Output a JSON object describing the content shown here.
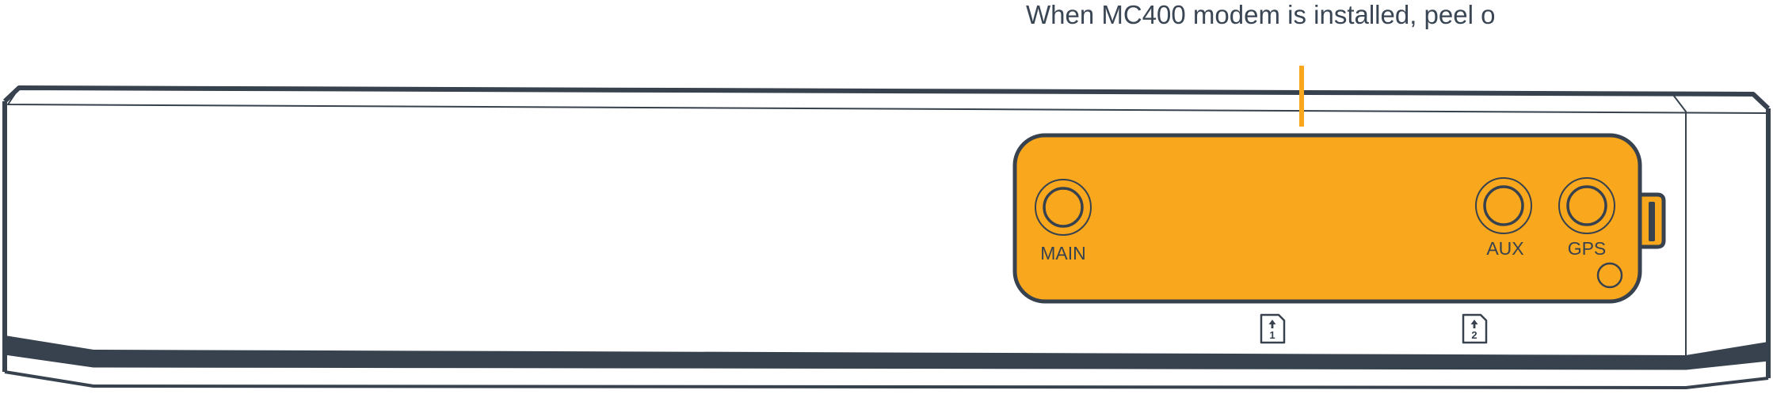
{
  "caption": "When MC400 modem is installed, peel o",
  "ports": {
    "main": "MAIN",
    "aux": "AUX",
    "gps": "GPS"
  },
  "sim_slots": [
    "1",
    "2"
  ],
  "colors": {
    "panel_fill": "#f9a81e",
    "outline": "#37424e",
    "callout_line": "#f9a81e",
    "background": "#ffffff"
  },
  "icons": {
    "sim_slot_1": "sim-card-icon",
    "sim_slot_2": "sim-card-icon",
    "antenna_port": "coax-connector-icon",
    "led": "status-led-icon"
  }
}
